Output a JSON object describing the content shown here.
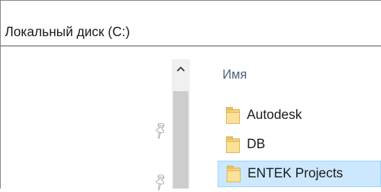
{
  "address": {
    "path": "Локальный диск (C:)"
  },
  "file_list": {
    "column_header": "Имя",
    "items": [
      {
        "name": "Autodesk",
        "selected": false
      },
      {
        "name": "DB",
        "selected": false
      },
      {
        "name": "ENTEK Projects",
        "selected": true
      }
    ]
  },
  "icons": {
    "pin": "pin-icon",
    "scroll_up": "chevron-up-icon",
    "folder": "folder-icon"
  },
  "colors": {
    "selection_bg": "#cce8ff",
    "selection_border": "#99d1ff",
    "folder": "#f5d27a"
  }
}
